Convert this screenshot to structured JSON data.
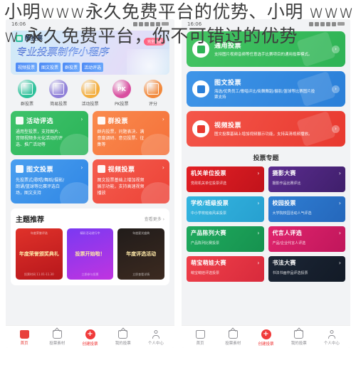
{
  "page": {
    "title_line1": "小明www永久免费平台的优势、小明 www",
    "title_line2": "w 永久免费平台，你不可错过的优势"
  },
  "left_phone": {
    "status": {
      "time": "16:06"
    },
    "banner": {
      "brand": "酷投票",
      "title": "专业投票制作小程序",
      "ribbon": "完全免费",
      "tags": [
        "视频投票",
        "图文投票",
        "群投票",
        "活动评选"
      ]
    },
    "quick_icons": [
      {
        "label": "群投票",
        "color": "#2ec19a",
        "glyph": ""
      },
      {
        "label": "简易投票",
        "color": "#8f7fd8",
        "glyph": ""
      },
      {
        "label": "活动投票",
        "color": "#f3ad3d",
        "glyph": ""
      },
      {
        "label": "PK投票",
        "color": "#d94fa0",
        "glyph": "PK"
      },
      {
        "label": "评分",
        "color": "#f2893c",
        "glyph": ""
      }
    ],
    "feature_cards": [
      {
        "title": "活动评选",
        "desc": "通用型投票，支持图片、音频视频多元化活动的评选、推广活动等",
        "color_a": "#3fc36b",
        "color_b": "#2bb358",
        "arrow": "›"
      },
      {
        "title": "群投票",
        "desc": "群内投票，问题表决、满意度调研、意见投票、征集等",
        "color_a": "#fa8a4d",
        "color_b": "#f4713a",
        "arrow": "›"
      },
      {
        "title": "图文投票",
        "desc": "先投票式/歌唱/舞蹈/摄影/朗诵/篮球等比赛评选白场，图文支持",
        "color_a": "#4a9ff0",
        "color_b": "#2f86e4",
        "arrow": "›"
      },
      {
        "title": "视频投票",
        "desc": "图文投票基础上增加视频展示功能，支持高速视频播放",
        "color_a": "#f55d4f",
        "color_b": "#ec4236",
        "arrow": "›"
      }
    ],
    "section": {
      "title": "主题推荐",
      "more": "查看更多 ›"
    },
    "theme_cards": [
      {
        "text": "年度荣誉颁奖典礼",
        "top": "年度荣誉评选",
        "bottom": "投票时间 11.01-11.30",
        "bg_a": "#e0322a",
        "bg_b": "#b6161b"
      },
      {
        "text": "投票开始啦！",
        "top": "精彩活动进行中",
        "bottom": "立即参与投票",
        "bg_a": "#7a39f2",
        "bg_b": "#c034e0"
      },
      {
        "text": "年度评选活动",
        "top": "年度星光盛典",
        "bottom": "立即查看详情",
        "bg_a": "#211c1a",
        "bg_b": "#3c2a20"
      }
    ],
    "tabs": [
      {
        "label": "首页",
        "type": "home",
        "state": "active"
      },
      {
        "label": "投票素材",
        "type": "material",
        "state": "normal"
      },
      {
        "label": "创建投票",
        "type": "plus",
        "state": "accent"
      },
      {
        "label": "我的投票",
        "type": "mine",
        "state": "normal"
      },
      {
        "label": "个人中心",
        "type": "person",
        "state": "normal"
      }
    ]
  },
  "right_phone": {
    "status": {
      "time": "16:06"
    },
    "type_cards": [
      {
        "title": "通用投票",
        "desc": "支持图片视频音频等任意选手比赛项目的通用投票模式。",
        "color_a": "#45c463",
        "color_b": "#2eb355",
        "icon_color": "#2eb355",
        "chev": "›"
      },
      {
        "title": "图文投票",
        "desc": "海选/优秀员工/歌唱评比/街舞舞蹈/摄影/篮球等比赛图片投票支持",
        "color_a": "#3f95e8",
        "color_b": "#2a7fd8",
        "icon_color": "#2a7fd8",
        "chev": "›"
      },
      {
        "title": "视频投票",
        "desc": "图文投票基础上增加视频展示功能，支持高清视频播放。",
        "color_a": "#f4564a",
        "color_b": "#e8392f",
        "icon_color": "#e8392f",
        "chev": "›"
      }
    ],
    "special_title": "投票专题",
    "special_cards": [
      {
        "title": "机关单位投票",
        "desc": "党政机关单位投票评选",
        "arrow": "›",
        "bg_a": "#e32025",
        "bg_b": "#c1131b"
      },
      {
        "title": "摄影大赛",
        "desc": "摄影作品比赛评比",
        "arrow": "›",
        "bg_a": "#5b2c8f",
        "bg_b": "#3f1f6b"
      },
      {
        "title": "学校/班级投票",
        "desc": "中小学校班级风采投票",
        "arrow": "›",
        "bg_a": "#34b5e0",
        "bg_b": "#27a0d0"
      },
      {
        "title": "校园投票",
        "desc": "大学院校园活动人气评选",
        "arrow": "›",
        "bg_a": "#2f7fd4",
        "bg_b": "#2567bb"
      },
      {
        "title": "产品陈列大赛",
        "desc": "产品陈列比赛投票",
        "arrow": "›",
        "bg_a": "#1faa5e",
        "bg_b": "#16924f"
      },
      {
        "title": "代言人评选",
        "desc": "产品/企业代言人评选",
        "arrow": "›",
        "bg_a": "#e0246d",
        "bg_b": "#c0165b"
      },
      {
        "title": "萌宝萌娃大赛",
        "desc": "萌宝萌娃评选投票",
        "arrow": "›",
        "bg_a": "#f0404a",
        "bg_b": "#d82a3c"
      },
      {
        "title": "书法大赛",
        "desc": "书法书画作品评选投票",
        "arrow": "›",
        "bg_a": "#1c2636",
        "bg_b": "#121a26"
      }
    ],
    "tabs": [
      {
        "label": "首页",
        "type": "home",
        "state": "normal"
      },
      {
        "label": "投票素材",
        "type": "material",
        "state": "normal"
      },
      {
        "label": "创建投票",
        "type": "plus",
        "state": "accent"
      },
      {
        "label": "我的投票",
        "type": "mine",
        "state": "normal"
      },
      {
        "label": "个人中心",
        "type": "person",
        "state": "normal"
      }
    ]
  }
}
